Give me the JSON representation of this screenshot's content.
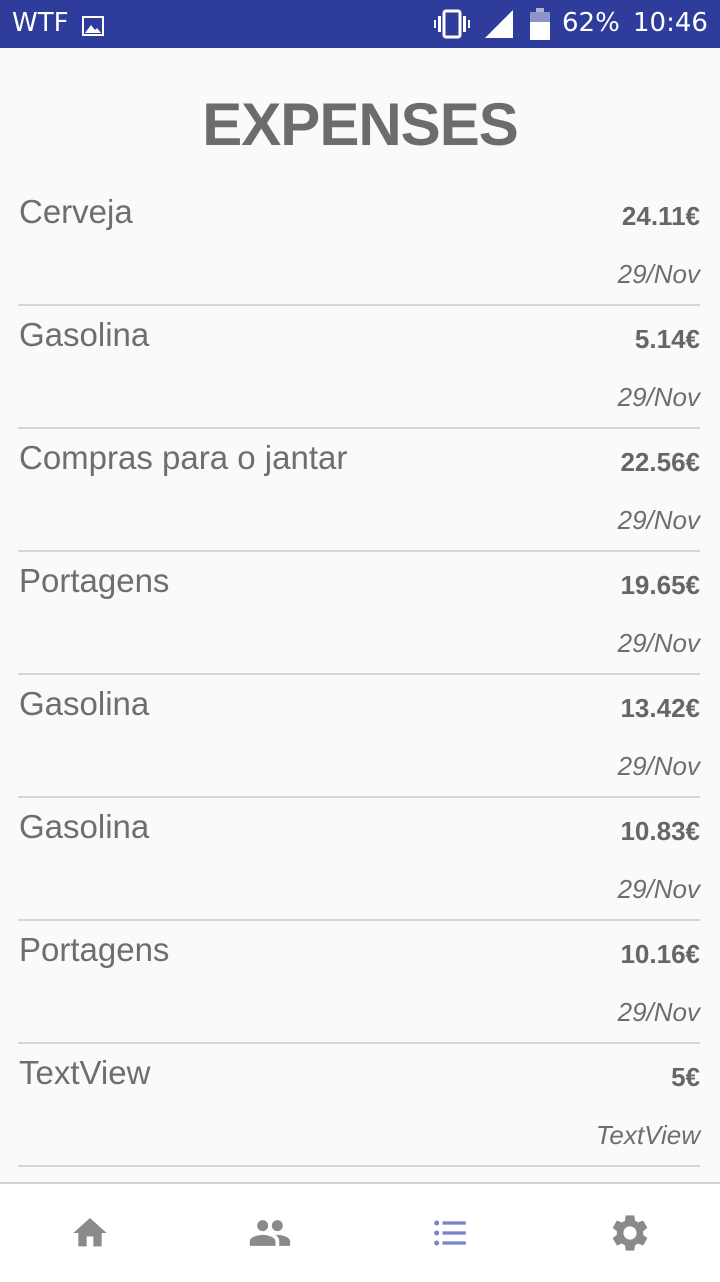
{
  "status_bar": {
    "carrier": "WTF",
    "battery": "62%",
    "time": "10:46"
  },
  "title": "EXPENSES",
  "expenses": [
    {
      "name": "Cerveja",
      "amount": "24.11€",
      "date": "29/Nov"
    },
    {
      "name": "Gasolina",
      "amount": "5.14€",
      "date": "29/Nov"
    },
    {
      "name": "Compras para o jantar",
      "amount": "22.56€",
      "date": "29/Nov"
    },
    {
      "name": "Portagens",
      "amount": "19.65€",
      "date": "29/Nov"
    },
    {
      "name": "Gasolina",
      "amount": "13.42€",
      "date": "29/Nov"
    },
    {
      "name": "Gasolina",
      "amount": "10.83€",
      "date": "29/Nov"
    },
    {
      "name": "Portagens",
      "amount": "10.16€",
      "date": "29/Nov"
    },
    {
      "name": "TextView",
      "amount": "5€",
      "date": "TextView"
    }
  ],
  "bottom_nav": {
    "items": [
      {
        "icon": "home-icon",
        "active": false
      },
      {
        "icon": "people-icon",
        "active": false
      },
      {
        "icon": "list-icon",
        "active": true
      },
      {
        "icon": "gear-icon",
        "active": false
      }
    ],
    "active_color": "#7986cb",
    "inactive_color": "#8a8a8a"
  },
  "colors": {
    "status_bar": "#2e3c9c",
    "background": "#fafafa",
    "text": "#6e6e6e"
  }
}
